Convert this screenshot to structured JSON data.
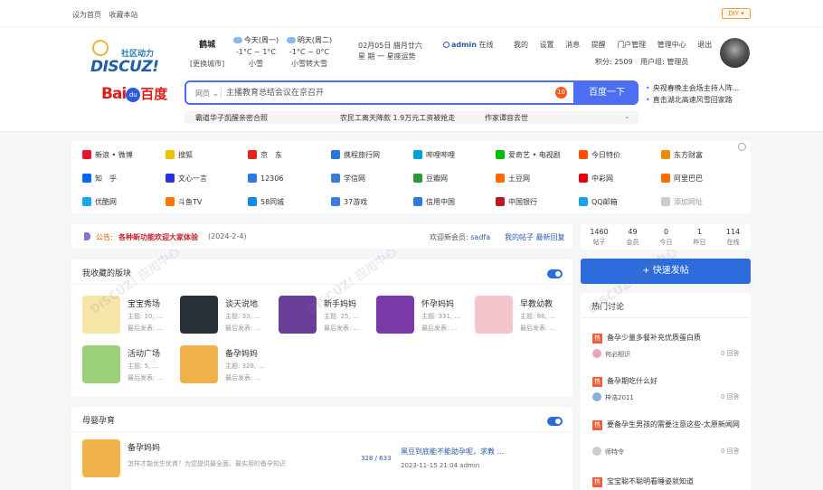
{
  "topbar": {
    "set_home": "设为首页",
    "bookmark": "收藏本站",
    "diy": "DIY"
  },
  "logo": {
    "sub": "社区动力",
    "main": "DISCUZ!"
  },
  "city": {
    "name": "鹤城",
    "change": "[更换城市]"
  },
  "weather": [
    {
      "head": "今天(周一)",
      "temp": "-1°C ~ 1°C",
      "desc": "小雪"
    },
    {
      "head": "明天(周二)",
      "temp": "-1°C ~ 0°C",
      "desc": "小雪转大雪"
    }
  ],
  "date": {
    "line1": "02月05日  腊月廿六",
    "line2": "星 期 一  星座运势"
  },
  "user": {
    "name": "admin",
    "status": "在线",
    "menu": [
      "我的",
      "设置",
      "消息",
      "提醒",
      "门户管理",
      "管理中心",
      "退出"
    ],
    "points": "积分: 2509",
    "group": "用户组: 管理员"
  },
  "baidu": {
    "bai": "Bai",
    "du": "du",
    "cn": "百度",
    "paw": "du"
  },
  "search": {
    "scope": "网页",
    "placeholder": "主播教育总结会议在京召开",
    "hot_badge": "10",
    "button": "百度一下",
    "hot_list": [
      "央视春晚主会场主持人阵...",
      "直击湖北高速风雪回家路"
    ],
    "suggest": [
      "霸道华子凯醒亲密合照",
      "农民工离天降款 1.9万元工资被抢走",
      "作家谭容去世"
    ]
  },
  "sites": [
    {
      "label": "新浪 • 微博",
      "color": "#e6162d"
    },
    {
      "label": "搜狐",
      "color": "#f0c000"
    },
    {
      "label": "京　东",
      "color": "#e1251b"
    },
    {
      "label": "携程旅行网",
      "color": "#2577e3"
    },
    {
      "label": "哔哩哔哩",
      "color": "#00a1d6"
    },
    {
      "label": "爱奇艺 • 电视剧",
      "color": "#00be06"
    },
    {
      "label": "今日特价",
      "color": "#ff5000"
    },
    {
      "label": "东方财富",
      "color": "#f08a00"
    },
    {
      "label": "知　乎",
      "color": "#0066ff"
    },
    {
      "label": "文心一言",
      "color": "#2932e1"
    },
    {
      "label": "12306",
      "color": "#2a7ae2"
    },
    {
      "label": "学信网",
      "color": "#3d7ad6"
    },
    {
      "label": "豆瓣网",
      "color": "#2e963d"
    },
    {
      "label": "土豆网",
      "color": "#ff6a00"
    },
    {
      "label": "中彩网",
      "color": "#e60012"
    },
    {
      "label": "阿里巴巴",
      "color": "#ff6a00"
    },
    {
      "label": "优酷网",
      "color": "#1ea4f3"
    },
    {
      "label": "斗鱼TV",
      "color": "#ff7700"
    },
    {
      "label": "58同城",
      "color": "#1a8ae0"
    },
    {
      "label": "37游戏",
      "color": "#3a7be0"
    },
    {
      "label": "信用中国",
      "color": "#2a7ae2"
    },
    {
      "label": "中国银行",
      "color": "#b81c22"
    },
    {
      "label": "QQ邮箱",
      "color": "#1aa3e8"
    },
    {
      "label": "添加网址",
      "color": "#cccccc"
    }
  ],
  "notice": {
    "label": "公告:",
    "message": "各种新功能欢迎大家体验",
    "date": "(2024-2-4)",
    "new_member_label": "欢迎新会员:",
    "new_member": "sadfa",
    "my_posts": "我的帖子 最新回复"
  },
  "stats": [
    {
      "num": "1460",
      "label": "帖子"
    },
    {
      "num": "49",
      "label": "会员"
    },
    {
      "num": "0",
      "label": "今日"
    },
    {
      "num": "1",
      "label": "昨日"
    },
    {
      "num": "114",
      "label": "在线"
    }
  ],
  "post_button": "+ 快速发帖",
  "favorites": {
    "title": "我收藏的版块",
    "boards": [
      {
        "name": "宝宝秀场",
        "meta": "主题: 10, ...",
        "last": "最后发表: ...",
        "color": "#f6e7a8"
      },
      {
        "name": "谈天说地",
        "meta": "主题: 33, ...",
        "last": "最后发表: ...",
        "color": "#2b3138"
      },
      {
        "name": "新手妈妈",
        "meta": "主题: 25, ...",
        "last": "最后发表: ...",
        "color": "#6a3f9a"
      },
      {
        "name": "怀孕妈妈",
        "meta": "主题: 331, ...",
        "last": "最后发表: ...",
        "color": "#7a3aa8"
      },
      {
        "name": "早教幼教",
        "meta": "主题: 86, ...",
        "last": "最后发表: ...",
        "color": "#f2c6cc"
      },
      {
        "name": "活动广场",
        "meta": "主题: 5, ...",
        "last": "最后发表: ...",
        "color": "#9bcf7a"
      },
      {
        "name": "备孕妈妈",
        "meta": "主题: 328, ...",
        "last": "最后发表: ...",
        "color": "#f0b34a"
      }
    ]
  },
  "category": {
    "title": "母婴孕育",
    "board_name": "备孕妈妈",
    "board_desc": "怎样才能优生优育？为您提供最全面、最实用的备孕知识",
    "counts": "328 / 633",
    "last_title": "黑豆到底能不能助孕呢，求教 ...",
    "last_time": "2023-11-15 21:04 admin"
  },
  "hot": {
    "title": "热门讨论",
    "tag": "热",
    "reply_suffix": "0 回答",
    "items": [
      {
        "title": "备孕少量多餐补充优质蛋白质",
        "author": "何必相识",
        "replies": "0 回答",
        "color": "#e9a6b8"
      },
      {
        "title": "备孕期吃什么好",
        "author": "梓浩2011",
        "replies": "0 回答",
        "color": "#8ab0d8"
      },
      {
        "title": "要备孕生男孩的需要注意这些-太原新闻网",
        "author": "师特令",
        "replies": "0 回答",
        "color": "#cccccc"
      },
      {
        "title": "宝宝聪不聪明看睡姿就知道",
        "author": "",
        "replies": "",
        "color": "#cccccc"
      }
    ]
  },
  "colors": {
    "accent": "#2c6bdb",
    "baidu_blue": "#4e6ef2",
    "hot_tag": "#f05a3a"
  }
}
